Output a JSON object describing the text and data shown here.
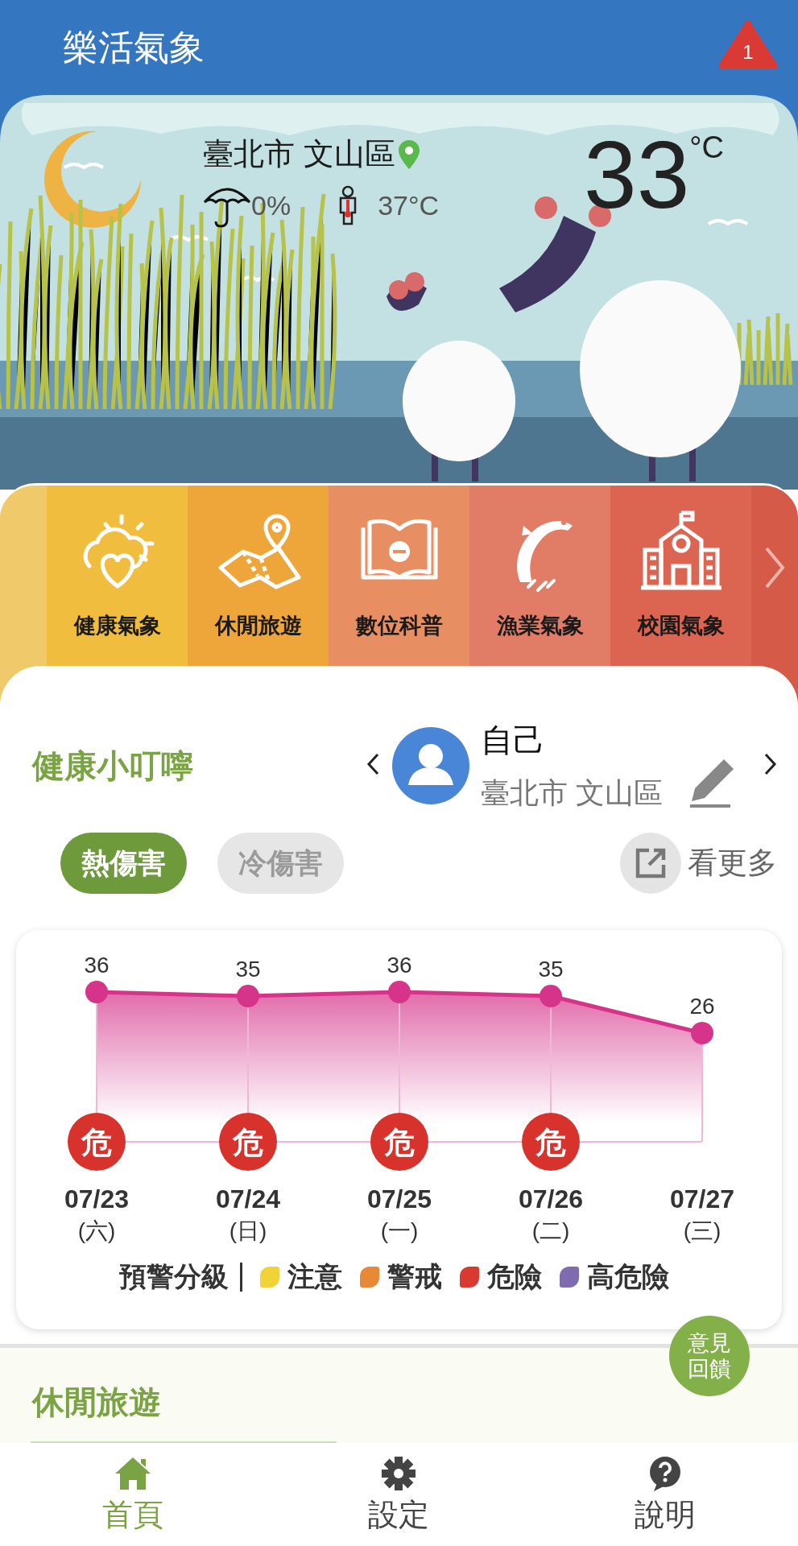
{
  "app_bar": {
    "title": "樂活氣象",
    "alert_count": "1"
  },
  "weather": {
    "location": "臺北市 文山區",
    "rain_chance": "0%",
    "feels_like": "37°C",
    "temperature": "33",
    "unit": "°C"
  },
  "categories": [
    {
      "label": "健康氣象",
      "color": "#f1bd3e"
    },
    {
      "label": "休閒旅遊",
      "color": "#eea53a"
    },
    {
      "label": "數位科普",
      "color": "#e78f62"
    },
    {
      "label": "漁業氣象",
      "color": "#e17c66"
    },
    {
      "label": "校園氣象",
      "color": "#dc6552"
    }
  ],
  "health": {
    "title": "健康小叮嚀",
    "profile": {
      "name": "自己",
      "location": "臺北市 文山區"
    },
    "tabs": [
      {
        "label": "熱傷害",
        "selected": true
      },
      {
        "label": "冷傷害",
        "selected": false
      }
    ],
    "more": "看更多",
    "chart_data": {
      "type": "area",
      "categories": [
        "07/23",
        "07/24",
        "07/25",
        "07/26",
        "07/27"
      ],
      "series": [
        {
          "color": "#d6338a",
          "values": [
            36,
            35,
            36,
            35,
            26
          ]
        }
      ],
      "data_labels": true,
      "grid": true
    },
    "days": [
      {
        "weekday": "(六)",
        "badge": "危"
      },
      {
        "weekday": "(日)",
        "badge": "危"
      },
      {
        "weekday": "(一)",
        "badge": "危"
      },
      {
        "weekday": "(二)",
        "badge": "危"
      },
      {
        "weekday": "(三)"
      }
    ],
    "legend": {
      "title": "預警分級",
      "items": [
        {
          "label": "注意",
          "color": "#f2d337"
        },
        {
          "label": "警戒",
          "color": "#e88a35"
        },
        {
          "label": "危險",
          "color": "#d83a30"
        },
        {
          "label": "高危險",
          "color": "#7e6bb0"
        }
      ]
    }
  },
  "feedback": {
    "lines": [
      "意見",
      "回饋"
    ]
  },
  "leisure": {
    "title": "休閒旅遊"
  },
  "nav": [
    {
      "label": "首頁",
      "selected": true
    },
    {
      "label": "設定",
      "selected": false
    },
    {
      "label": "說明",
      "selected": false
    }
  ]
}
